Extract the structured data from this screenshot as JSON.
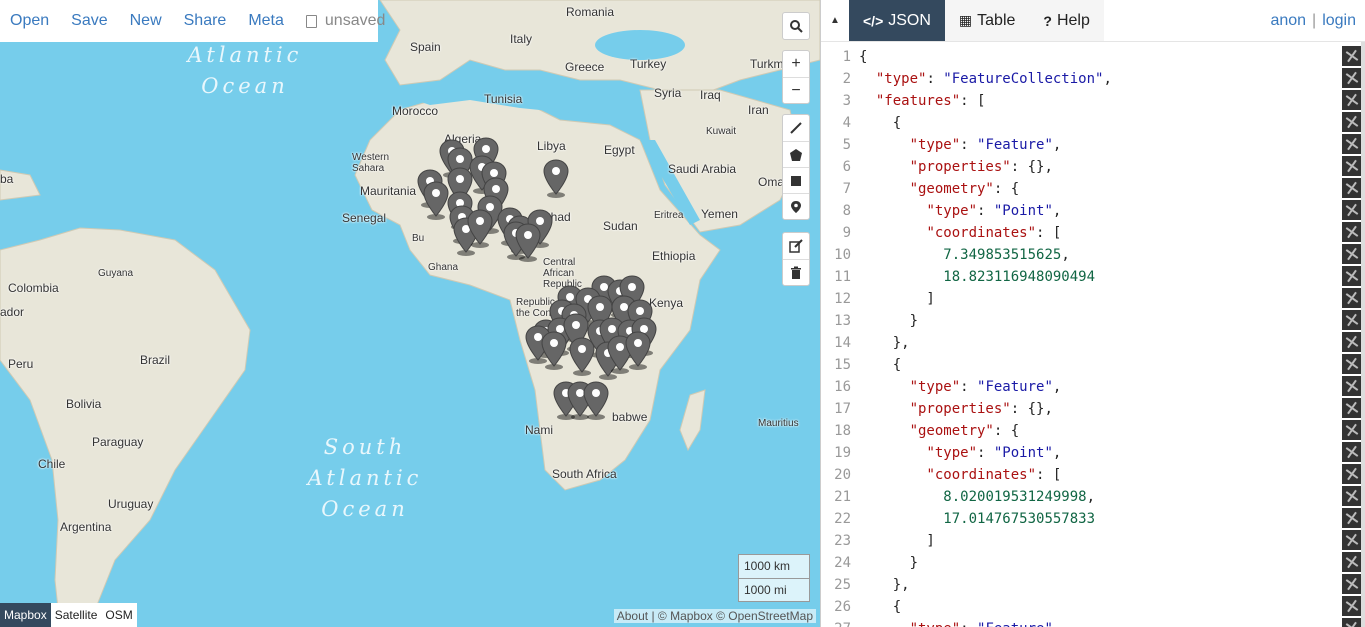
{
  "toolbar": {
    "open": "Open",
    "save": "Save",
    "new": "New",
    "share": "Share",
    "meta": "Meta",
    "status": "unsaved"
  },
  "map": {
    "ocean_labels": {
      "atlantic": "Atlantic\nOcean",
      "south_atlantic": "South\nAtlantic\nOcean"
    },
    "place_labels": [
      "Romania",
      "Spain",
      "Italy",
      "Greece",
      "Turkey",
      "Turkm",
      "Tunisia",
      "Syria",
      "Iraq",
      "Iran",
      "Morocco",
      "Algeria",
      "Libya",
      "Egypt",
      "Kuwait",
      "Saudi Arabia",
      "Oma",
      "Western Sahara",
      "Mauritania",
      "Senegal",
      "Chad",
      "Sudan",
      "Eritrea",
      "Yemen",
      "Ghana",
      "Bu",
      "Central African Republic",
      "Ethiopia",
      "Guyana",
      "Colombia",
      "ador",
      "Republic of the Congo",
      "Kenya",
      "Peru",
      "Brazil",
      "Bolivia",
      "Paraguay",
      "Chile",
      "Uruguay",
      "Argentina",
      "Nami",
      "babwe",
      "Mauritius",
      "South Africa",
      "ba"
    ],
    "scale_km": "1000 km",
    "scale_mi": "1000 mi",
    "layers": [
      "Mapbox",
      "Satellite",
      "OSM"
    ],
    "active_layer": "Mapbox",
    "attribution": "About | © Mapbox © OpenStreetMap",
    "pin_color": "#666666",
    "water_color": "#76cdeb",
    "land_color": "#e8e6d9"
  },
  "tools": {
    "search": "search-icon",
    "zoom_in": "+",
    "zoom_out": "−",
    "draw": [
      "line-icon",
      "polygon-icon",
      "rectangle-icon",
      "marker-icon"
    ],
    "edit": [
      "edit-icon",
      "trash-icon"
    ]
  },
  "panel": {
    "collapse": "▲",
    "tabs": [
      {
        "icon": "</>",
        "label": "JSON"
      },
      {
        "icon": "▦",
        "label": "Table"
      },
      {
        "icon": "?",
        "label": "Help"
      }
    ],
    "active_tab": "JSON",
    "user": "anon",
    "login": "login",
    "sep": "|"
  },
  "editor": {
    "lines": [
      "{",
      "  \"type\": \"FeatureCollection\",",
      "  \"features\": [",
      "    {",
      "      \"type\": \"Feature\",",
      "      \"properties\": {},",
      "      \"geometry\": {",
      "        \"type\": \"Point\",",
      "        \"coordinates\": [",
      "          7.349853515625,",
      "          18.823116948090494",
      "        ]",
      "      }",
      "    },",
      "    {",
      "      \"type\": \"Feature\",",
      "      \"properties\": {},",
      "      \"geometry\": {",
      "        \"type\": \"Point\",",
      "        \"coordinates\": [",
      "          8.020019531249998,",
      "          17.014767530557833",
      "        ]",
      "      }",
      "    },",
      "    {",
      "      \"type\": \"Feature\","
    ]
  }
}
